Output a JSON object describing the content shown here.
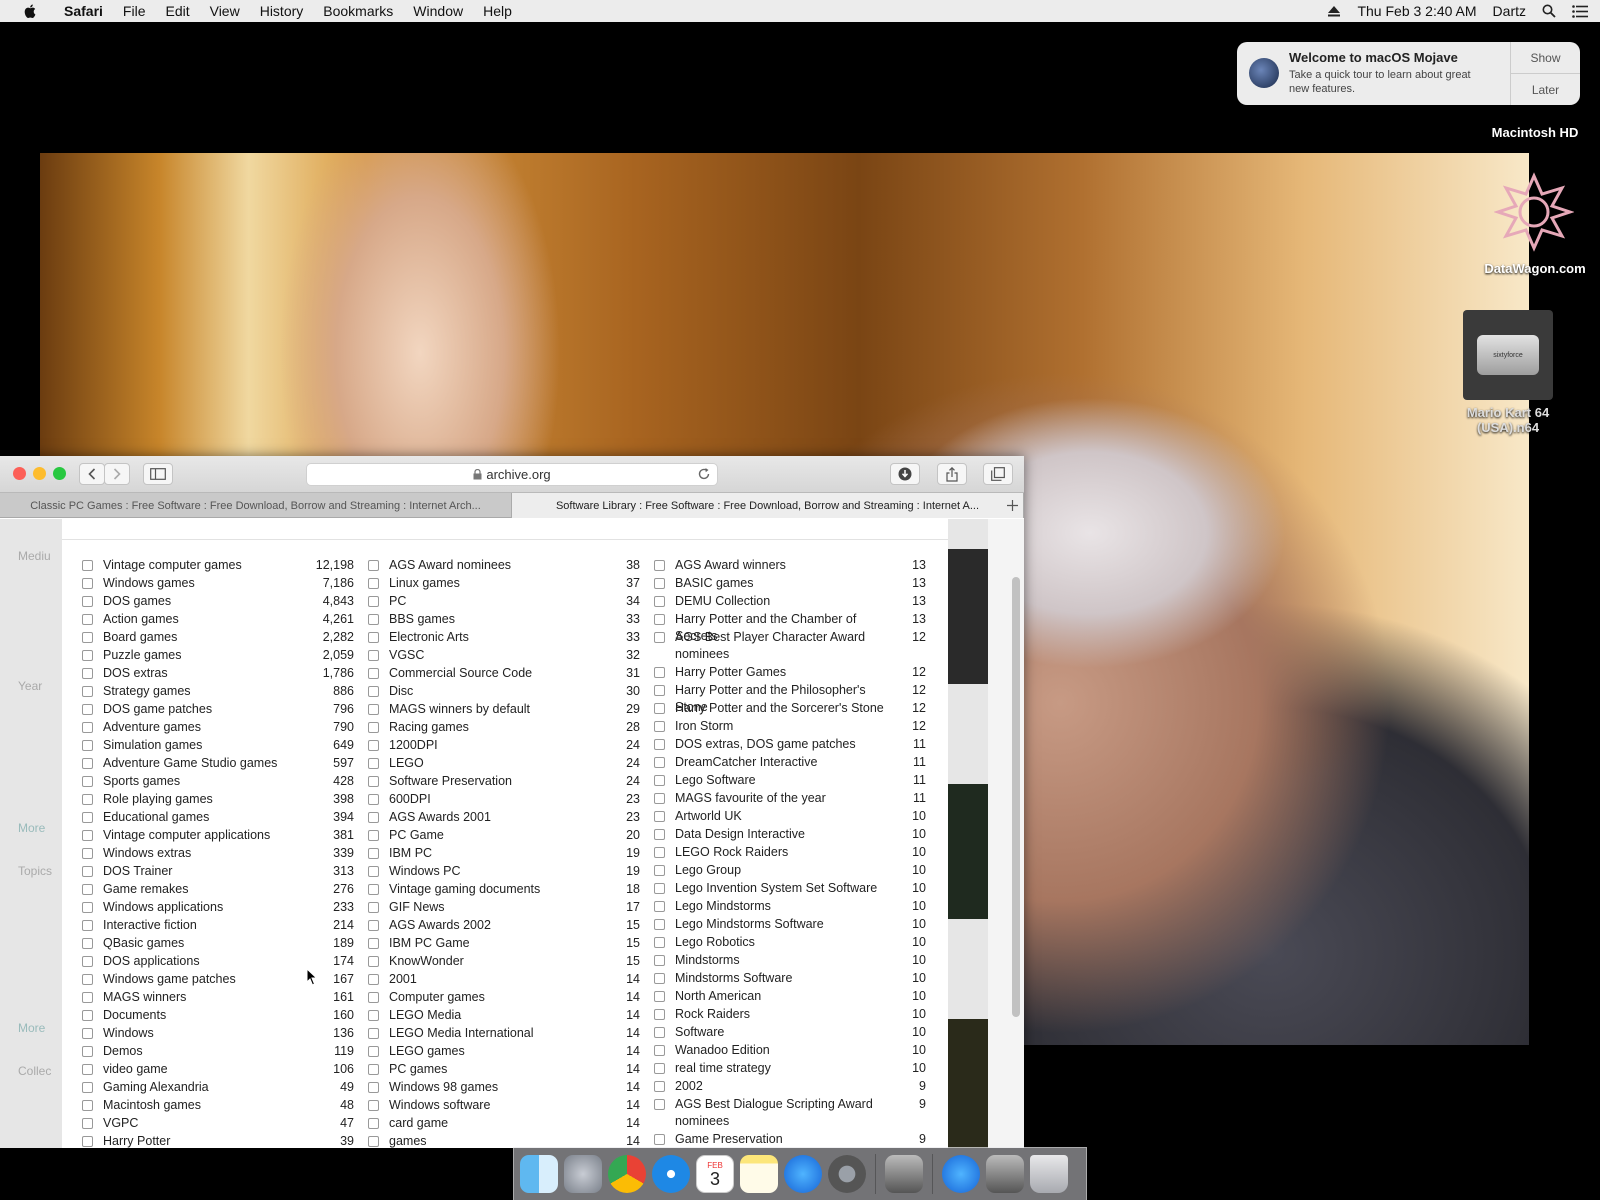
{
  "menubar": {
    "app": "Safari",
    "items": [
      "File",
      "Edit",
      "View",
      "History",
      "Bookmarks",
      "Window",
      "Help"
    ],
    "datetime": "Thu Feb 3  2:40 AM",
    "user": "Dartz"
  },
  "notification": {
    "title": "Welcome to macOS Mojave",
    "body": "Take a quick tour to learn about great new features.",
    "show": "Show",
    "later": "Later"
  },
  "desktop": {
    "hd_label": "Macintosh HD",
    "datawagon_label": "DataWagon.com",
    "rom_label": "Mario Kart 64 (USA).n64",
    "rom_icon_text": "sixtyforce"
  },
  "safari": {
    "url": "archive.org",
    "tabs": [
      "Classic PC Games : Free Software : Free Download, Borrow and Streaming : Internet Arch...",
      "Software Library : Free Software : Free Download, Borrow and Streaming : Internet A..."
    ]
  },
  "topics": {
    "col1": [
      {
        "label": "Vintage computer games",
        "count": "12,198"
      },
      {
        "label": "Windows games",
        "count": "7,186"
      },
      {
        "label": "DOS games",
        "count": "4,843"
      },
      {
        "label": "Action games",
        "count": "4,261"
      },
      {
        "label": "Board games",
        "count": "2,282"
      },
      {
        "label": "Puzzle games",
        "count": "2,059"
      },
      {
        "label": "DOS extras",
        "count": "1,786"
      },
      {
        "label": "Strategy games",
        "count": "886"
      },
      {
        "label": "DOS game patches",
        "count": "796"
      },
      {
        "label": "Adventure games",
        "count": "790"
      },
      {
        "label": "Simulation games",
        "count": "649"
      },
      {
        "label": "Adventure Game Studio games",
        "count": "597"
      },
      {
        "label": "Sports games",
        "count": "428"
      },
      {
        "label": "Role playing games",
        "count": "398"
      },
      {
        "label": "Educational games",
        "count": "394"
      },
      {
        "label": "Vintage computer applications",
        "count": "381"
      },
      {
        "label": "Windows extras",
        "count": "339"
      },
      {
        "label": "DOS Trainer",
        "count": "313"
      },
      {
        "label": "Game remakes",
        "count": "276"
      },
      {
        "label": "Windows applications",
        "count": "233"
      },
      {
        "label": "Interactive fiction",
        "count": "214"
      },
      {
        "label": "QBasic games",
        "count": "189"
      },
      {
        "label": "DOS applications",
        "count": "174"
      },
      {
        "label": "Windows game patches",
        "count": "167"
      },
      {
        "label": "MAGS winners",
        "count": "161"
      },
      {
        "label": "Documents",
        "count": "160"
      },
      {
        "label": "Windows",
        "count": "136"
      },
      {
        "label": "Demos",
        "count": "119"
      },
      {
        "label": "video game",
        "count": "106"
      },
      {
        "label": "Gaming Alexandria",
        "count": "49"
      },
      {
        "label": "Macintosh games",
        "count": "48"
      },
      {
        "label": "VGPC",
        "count": "47"
      },
      {
        "label": "Harry Potter",
        "count": "39"
      }
    ],
    "col2": [
      {
        "label": "AGS Award nominees",
        "count": "38"
      },
      {
        "label": "Linux games",
        "count": "37"
      },
      {
        "label": "PC",
        "count": "34"
      },
      {
        "label": "BBS games",
        "count": "33"
      },
      {
        "label": "Electronic Arts",
        "count": "33"
      },
      {
        "label": "VGSC",
        "count": "32"
      },
      {
        "label": "Commercial Source Code",
        "count": "31"
      },
      {
        "label": "Disc",
        "count": "30"
      },
      {
        "label": "MAGS winners by default",
        "count": "29"
      },
      {
        "label": "Racing games",
        "count": "28"
      },
      {
        "label": "1200DPI",
        "count": "24"
      },
      {
        "label": "LEGO",
        "count": "24"
      },
      {
        "label": "Software Preservation",
        "count": "24"
      },
      {
        "label": "600DPI",
        "count": "23"
      },
      {
        "label": "AGS Awards 2001",
        "count": "23"
      },
      {
        "label": "PC Game",
        "count": "20"
      },
      {
        "label": "IBM PC",
        "count": "19"
      },
      {
        "label": "Windows PC",
        "count": "19"
      },
      {
        "label": "Vintage gaming documents",
        "count": "18"
      },
      {
        "label": "GIF News",
        "count": "17"
      },
      {
        "label": "AGS Awards 2002",
        "count": "15"
      },
      {
        "label": "IBM PC Game",
        "count": "15"
      },
      {
        "label": "KnowWonder",
        "count": "15"
      },
      {
        "label": "2001",
        "count": "14"
      },
      {
        "label": "Computer games",
        "count": "14"
      },
      {
        "label": "LEGO Media",
        "count": "14"
      },
      {
        "label": "LEGO Media International",
        "count": "14"
      },
      {
        "label": "LEGO games",
        "count": "14"
      },
      {
        "label": "PC games",
        "count": "14"
      },
      {
        "label": "Windows 98 games",
        "count": "14"
      },
      {
        "label": "Windows software",
        "count": "14"
      },
      {
        "label": "card game",
        "count": "14"
      },
      {
        "label": "games",
        "count": "14"
      }
    ],
    "col3": [
      {
        "label": "AGS Award winners",
        "count": "13"
      },
      {
        "label": "BASIC games",
        "count": "13"
      },
      {
        "label": "DEMU Collection",
        "count": "13"
      },
      {
        "label": "Harry Potter and the Chamber of Secrets",
        "count": "13"
      },
      {
        "label": "AGS Best Player Character Award nominees",
        "count": "12"
      },
      {
        "label": "Harry Potter Games",
        "count": "12"
      },
      {
        "label": "Harry Potter and the Philosopher's Stone",
        "count": "12"
      },
      {
        "label": "Harry Potter and the Sorcerer's Stone",
        "count": "12"
      },
      {
        "label": "Iron Storm",
        "count": "12"
      },
      {
        "label": "DOS extras, DOS game patches",
        "count": "11"
      },
      {
        "label": "DreamCatcher Interactive",
        "count": "11"
      },
      {
        "label": "Lego Software",
        "count": "11"
      },
      {
        "label": "MAGS favourite of the year",
        "count": "11"
      },
      {
        "label": "Artworld UK",
        "count": "10"
      },
      {
        "label": "Data Design Interactive",
        "count": "10"
      },
      {
        "label": "LEGO Rock Raiders",
        "count": "10"
      },
      {
        "label": "Lego Group",
        "count": "10"
      },
      {
        "label": "Lego Invention System Set Software",
        "count": "10"
      },
      {
        "label": "Lego Mindstorms",
        "count": "10"
      },
      {
        "label": "Lego Mindstorms Software",
        "count": "10"
      },
      {
        "label": "Lego Robotics",
        "count": "10"
      },
      {
        "label": "Mindstorms",
        "count": "10"
      },
      {
        "label": "Mindstorms Software",
        "count": "10"
      },
      {
        "label": "North American",
        "count": "10"
      },
      {
        "label": "Rock Raiders",
        "count": "10"
      },
      {
        "label": "Software",
        "count": "10"
      },
      {
        "label": "Wanadoo Edition",
        "count": "10"
      },
      {
        "label": "real time strategy",
        "count": "10"
      },
      {
        "label": "2002",
        "count": "9"
      },
      {
        "label": "AGS Best Dialogue Scripting Award nominees",
        "count": "9"
      },
      {
        "label": "Game Preservation",
        "count": "9"
      }
    ]
  },
  "sidebar_partial": [
    "Mediu",
    "Year",
    "More",
    "Topics",
    "More",
    "Collec"
  ],
  "dock": {
    "calendar_month": "FEB",
    "calendar_day": "3"
  }
}
